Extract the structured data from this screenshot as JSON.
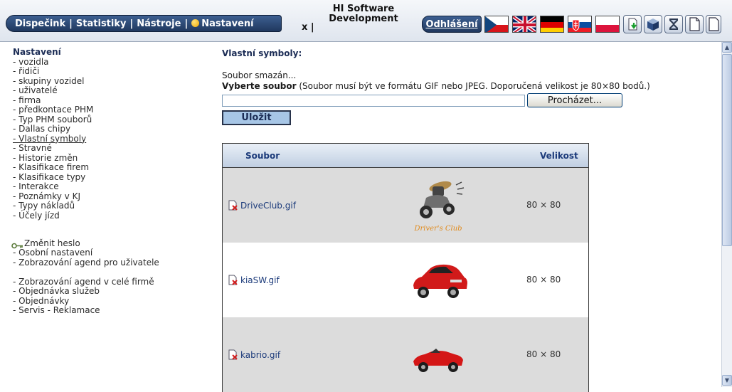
{
  "header": {
    "menu": {
      "dispatch": "Dispečink",
      "stats": "Statistiky",
      "tools": "Nástroje",
      "settings": "Nastavení",
      "separator": "|"
    },
    "close": "x |",
    "brand_line1": "HI Software",
    "brand_line2": "Development",
    "logout": "Odhlášení"
  },
  "nav": {
    "title": "Nastavení",
    "items": [
      "- vozidla",
      "- řidiči",
      "- skupiny vozidel",
      "- uživatelé",
      "- firma",
      "- předkontace PHM",
      "- Typ PHM souborů",
      "- Dallas chipy",
      "- Vlastní symboly",
      "- Stravné",
      "- Historie změn",
      "- Klasifikace firem",
      "- Klasifikace typy",
      "- Interakce",
      "- Poznámky v KJ",
      "- Typy nákladů",
      "- Účely jízd"
    ],
    "change_password": "Změnit heslo",
    "personal": "- Osobní nastavení",
    "agenda_user": "- Zobrazování agend pro uživatele",
    "agenda_company": "- Zobrazování agend v celé firmě",
    "order_services": "- Objednávka služeb",
    "orders": "- Objednávky",
    "service": "- Servis - Reklamace"
  },
  "main": {
    "title": "Vlastní symboly:",
    "status": "Soubor smazán...",
    "choose_bold": "Vyberte soubor",
    "choose_note": " (Soubor musí být ve formátu GIF nebo JPEG. Doporučená velikost je 80×80 bodů.)",
    "file_value": "",
    "browse_label": "Procházet...",
    "save_label": "Uložit",
    "table": {
      "col_file": "Soubor",
      "col_size": "Velikost",
      "rows": [
        {
          "name": "DriveClub.gif",
          "size": "80 × 80",
          "logo_caption": "Driver's Club"
        },
        {
          "name": "kiaSW.gif",
          "size": "80 × 80"
        },
        {
          "name": "kabrio.gif",
          "size": "80 × 80"
        }
      ]
    }
  },
  "colors": {
    "nav_pill": "#2b4a78",
    "save_button": "#a7c6e6",
    "row_shade": "#dcdcdc",
    "link": "#1b3a7a"
  },
  "icons": {
    "flags": [
      "czech-flag-icon",
      "uk-flag-icon",
      "german-flag-icon",
      "slovak-flag-icon",
      "polish-flag-icon"
    ],
    "tools": [
      "export-icon",
      "cube-icon",
      "hourglass-icon",
      "document-icon"
    ]
  }
}
